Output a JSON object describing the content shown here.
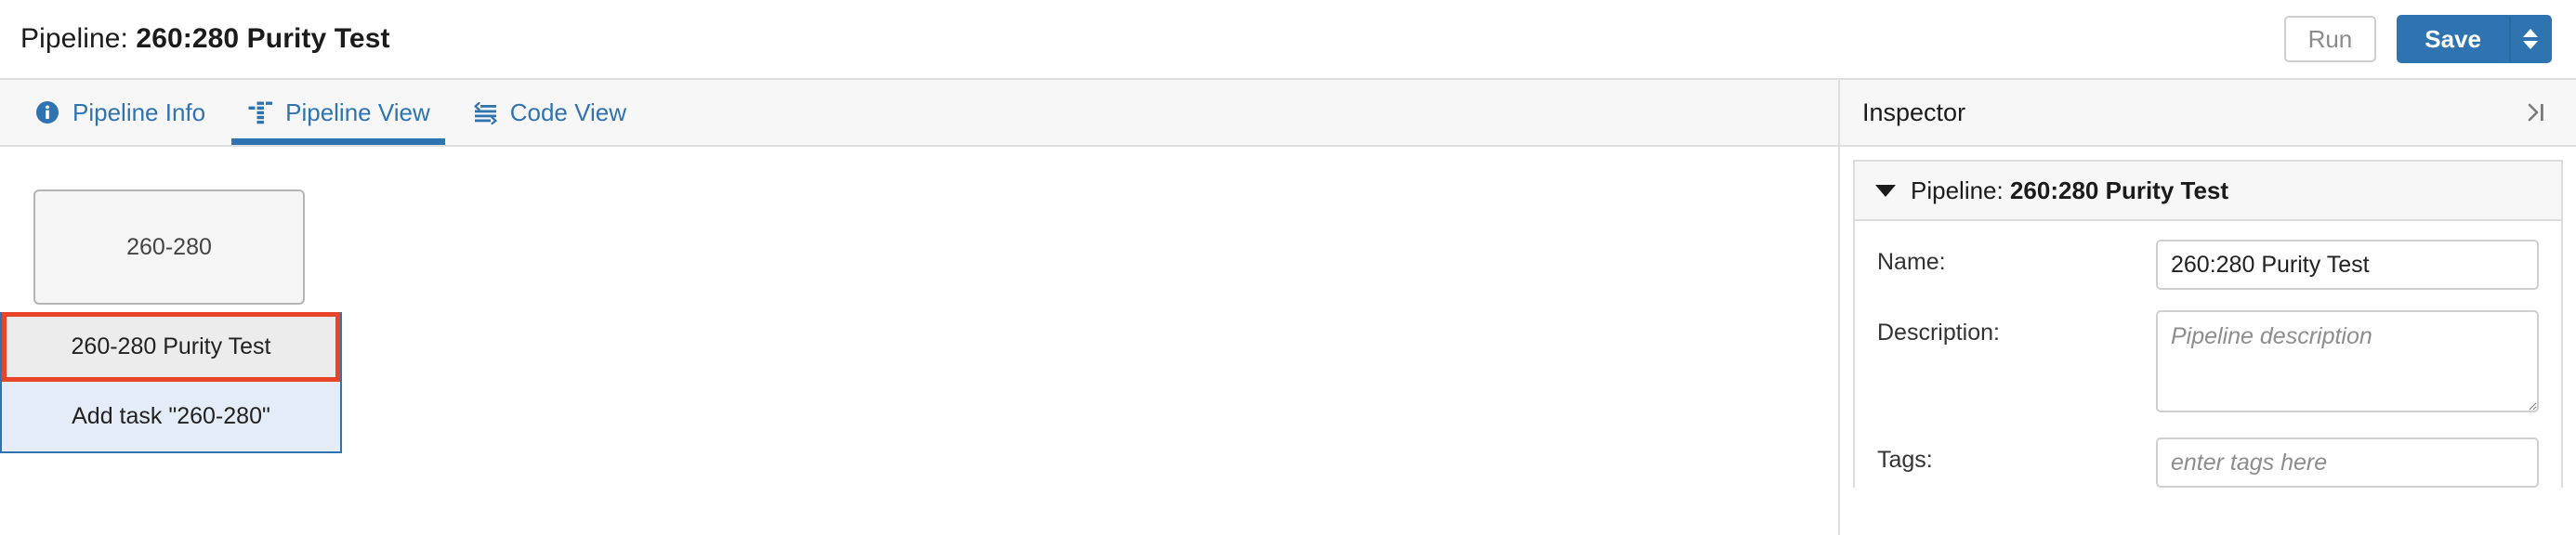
{
  "header": {
    "title_prefix": "Pipeline: ",
    "title_name": "260:280 Purity Test",
    "run_label": "Run",
    "save_label": "Save",
    "save_dropdown_icon": "caret-up-down-icon"
  },
  "tabs": [
    {
      "label": "Pipeline Info",
      "icon": "info-circle-icon",
      "active": false
    },
    {
      "label": "Pipeline View",
      "icon": "sitemap-icon",
      "active": true
    },
    {
      "label": "Code View",
      "icon": "code-indent-icon",
      "active": false
    }
  ],
  "canvas": {
    "node": {
      "label": "260-280"
    },
    "suggestions": [
      {
        "label": "260-280 Purity Test",
        "state": "highlighted"
      },
      {
        "label": "Add task \"260-280\"",
        "state": "add-task"
      }
    ]
  },
  "inspector": {
    "title": "Inspector",
    "collapse_icon": "collapse-right-icon",
    "section": {
      "toggle_icon": "triangle-down-icon",
      "title_prefix": "Pipeline: ",
      "title_name": "260:280 Purity Test"
    },
    "fields": {
      "name_label": "Name:",
      "name_value": "260:280 Purity Test",
      "description_label": "Description:",
      "description_placeholder": "Pipeline description",
      "description_value": "",
      "tags_label": "Tags:",
      "tags_placeholder": "enter tags here",
      "tags_value": ""
    }
  },
  "colors": {
    "accent_blue": "#2f73b0",
    "highlight_red": "#e8442a",
    "add_task_blue_bg": "#e4edf7",
    "panel_gray": "#f7f7f7"
  }
}
